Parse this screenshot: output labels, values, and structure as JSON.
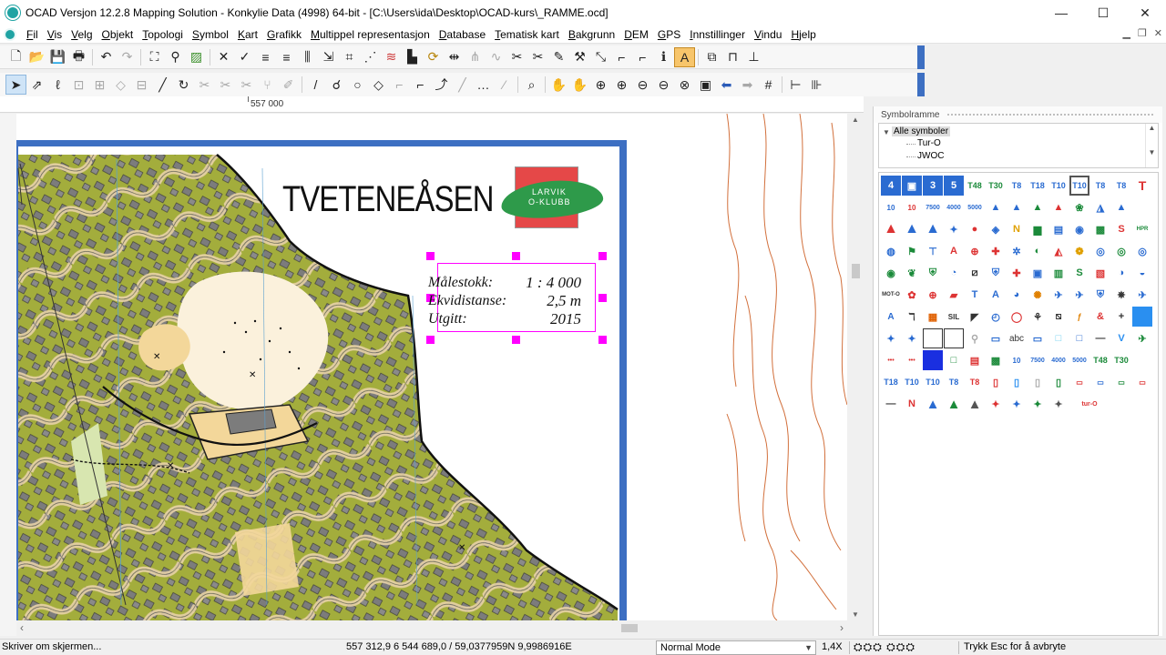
{
  "window": {
    "title": "OCAD Versjon 12.2.8  Mapping Solution - Konkylie Data (4998) 64-bit - [C:\\Users\\ida\\Desktop\\OCAD-kurs\\_RAMME.ocd]",
    "minimize": "—",
    "maximize": "☐",
    "close": "✕"
  },
  "menu": [
    "Fil",
    "Vis",
    "Velg",
    "Objekt",
    "Topologi",
    "Symbol",
    "Kart",
    "Grafikk",
    "Multippel representasjon",
    "Database",
    "Tematisk kart",
    "Bakgrunn",
    "DEM",
    "GPS",
    "Innstillinger",
    "Vindu",
    "Hjelp"
  ],
  "ruler": {
    "label": "557 000"
  },
  "map": {
    "title": "TVETENEÅSEN",
    "club_line1": "LARVIK",
    "club_line2": "O-KLUBB",
    "scale_label": "Målestokk:",
    "scale_value": "1 : 4 000",
    "contour_label": "Ekvidistanse:",
    "contour_value": "2,5 m",
    "issued_label": "Utgitt:",
    "issued_value": "2015"
  },
  "panel": {
    "title": "Symbolramme",
    "tree": [
      "Alle symboler",
      "Tur-O",
      "JWOC"
    ]
  },
  "symbols": {
    "row1": [
      "4",
      "▣",
      "3",
      "5",
      "T48",
      "T30",
      "T8",
      "T18",
      "T10",
      "T10",
      "T8",
      "T8",
      "T"
    ],
    "row2": [
      "10",
      "10",
      "7500",
      "4000",
      "5000"
    ],
    "labels_misc": [
      "abc",
      "SIL",
      "MOT-O",
      "tur-O"
    ],
    "row8": [
      "10",
      "7500",
      "4000",
      "5000",
      "T48",
      "T30"
    ],
    "row9": [
      "T18",
      "T10",
      "T10",
      "T8",
      "T8"
    ]
  },
  "colors": {
    "accent": "#3d6fc2",
    "vegetation": "#a3ad3c",
    "open_land": "#f3d79a",
    "contour": "#d2703c",
    "selection": "#ff00ff"
  },
  "status": {
    "left": "Skriver om skjermen...",
    "coords": "557 312,9    6 544 689,0  /  59,0377959N  9,9986916E",
    "mode": "Normal Mode",
    "zoom": "1,4X",
    "hint": "Trykk Esc for å avbryte"
  }
}
